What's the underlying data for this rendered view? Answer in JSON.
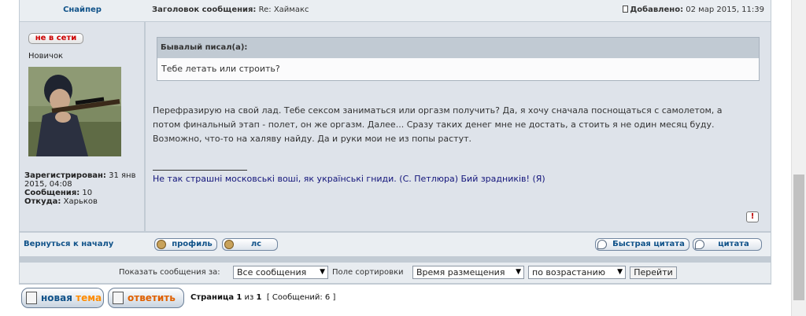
{
  "post": {
    "author": "Снайпер",
    "subject_label": "Заголовок сообщения:",
    "subject": "Re: Хаймакс",
    "posted_label": "Добавлено:",
    "posted_date": "02 мар 2015, 11:39"
  },
  "poster": {
    "status": "не в сети",
    "rank": "Новичок",
    "registered_label": "Зарегистрирован:",
    "registered_value": "31 янв 2015, 04:08",
    "posts_label": "Сообщения:",
    "posts_value": "10",
    "from_label": "Откуда:",
    "from_value": "Харьков"
  },
  "quote": {
    "header": "Бывалый писал(а):",
    "text": "Тебе летать или строить?"
  },
  "body": {
    "line1": "Перефразирую на свой лад. Тебе сексом заниматься или оргазм получить? Да, я хочу сначала поснощаться с самолетом, а",
    "line2": "потом финальный этап - полет, он же оргазм. Далее... Сразу таких денег мне не достать, а стоить я не один месяц буду.",
    "line3": "Возможно, что-то на халяву найду. Да и руки мои не из попы растут."
  },
  "signature": "Не так страшні московські воші, як українські гниди. (С. Петлюра) Бий зрадників! (Я)",
  "actions": {
    "back_to_top": "Вернуться к началу",
    "profile": "профиль",
    "pm": "лс",
    "quick_quote": "Быстрая цитата",
    "quote": "цитата"
  },
  "sort": {
    "show_label": "Показать сообщения за:",
    "show_value": "Все сообщения",
    "sort_label": "Поле сортировки",
    "sort_value": "Время размещения",
    "order_value": "по возрастанию",
    "go": "Перейти"
  },
  "buttons": {
    "new_topic_1": "новая",
    "new_topic_2": "тема",
    "reply": "ответить"
  },
  "pagination": {
    "page_label": "Страница",
    "current": "1",
    "of_label": "из",
    "total": "1",
    "messages": "[ Сообщений: 6 ]"
  },
  "colors": {
    "link": "#105289",
    "offline": "#cc0000",
    "signature": "#12147a",
    "new_topic_accent": "#ff8c00",
    "reply_accent": "#e06000"
  }
}
